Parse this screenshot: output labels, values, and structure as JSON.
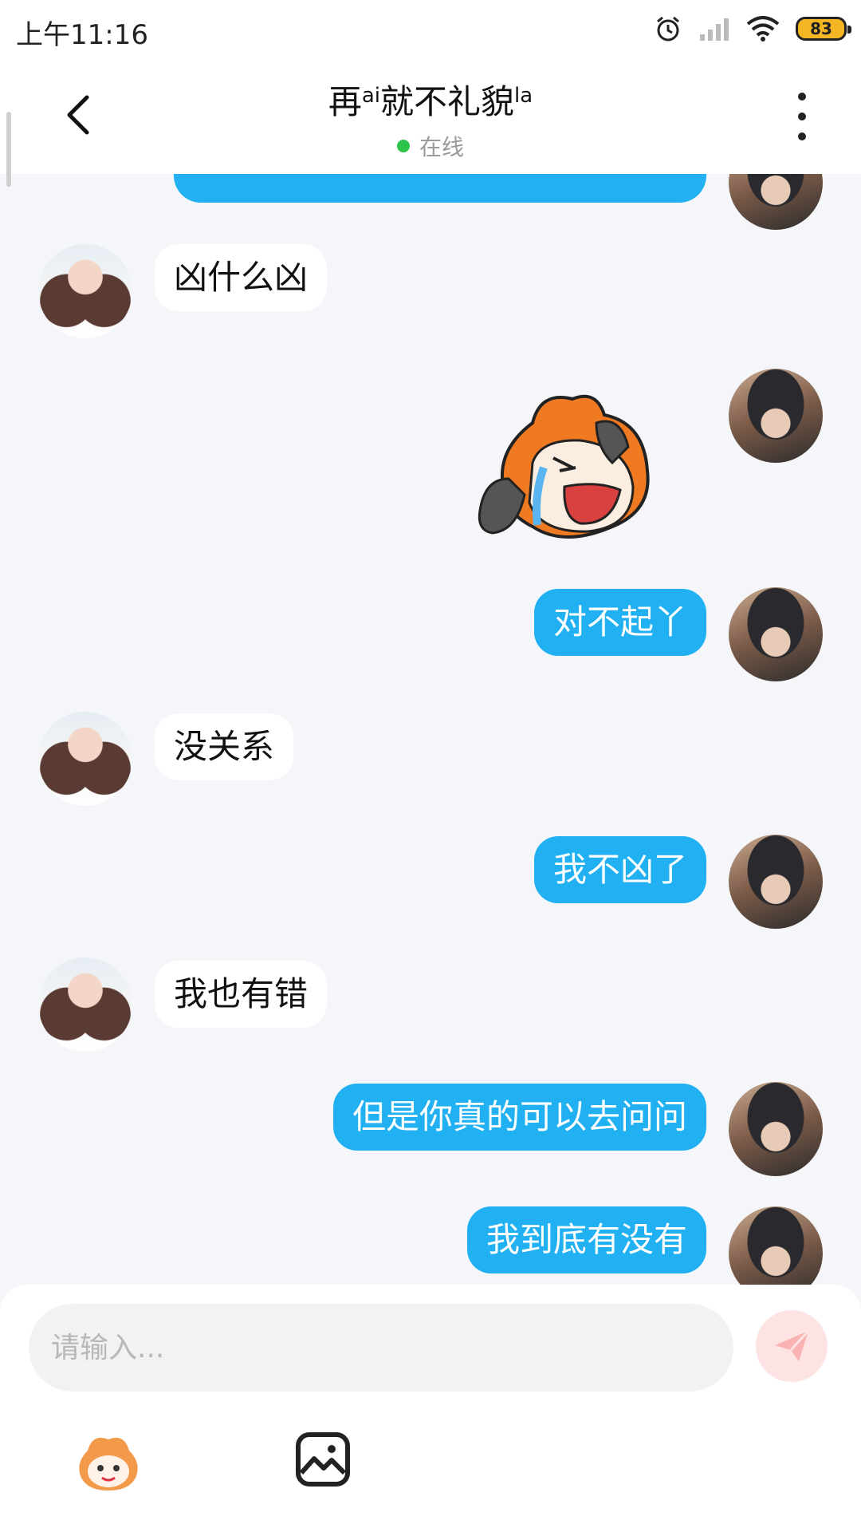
{
  "status_bar": {
    "time": "上午11:16",
    "battery": "83"
  },
  "header": {
    "title_main": "再",
    "title_sup1": "ai",
    "title_mid": "就不礼貌",
    "title_sup2": "la",
    "status": "在线"
  },
  "messages": [
    {
      "side": "in",
      "text": "凶什么凶"
    },
    {
      "side": "out",
      "type": "sticker"
    },
    {
      "side": "out",
      "text": "对不起丫"
    },
    {
      "side": "in",
      "text": "没关系"
    },
    {
      "side": "out",
      "text": "我不凶了"
    },
    {
      "side": "in",
      "text": "我也有错"
    },
    {
      "side": "out",
      "text": "但是你真的可以去问问"
    },
    {
      "side": "out",
      "text": "我到底有没有"
    }
  ],
  "input": {
    "placeholder": "请输入..."
  },
  "colors": {
    "outgoing_bubble": "#21b1f2",
    "incoming_bubble": "#ffffff",
    "background": "#f4f6f9",
    "online": "#2ec34a"
  }
}
